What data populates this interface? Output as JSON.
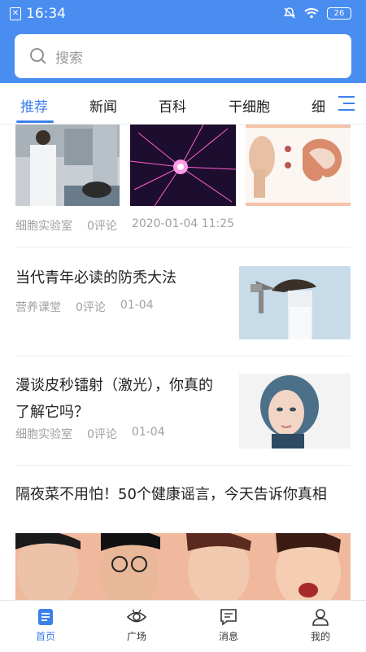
{
  "status_bar": {
    "time": "16:34",
    "battery": "26"
  },
  "search": {
    "placeholder": "搜索"
  },
  "tabs": [
    {
      "label": "推荐"
    },
    {
      "label": "新闻"
    },
    {
      "label": "百科"
    },
    {
      "label": "干细胞"
    },
    {
      "label": "细"
    }
  ],
  "feed": {
    "item1": {
      "source": "细胞实验室",
      "comments": "0评论",
      "time": "2020-01-04 11:25"
    },
    "item2": {
      "title": "当代青年必读的防秃大法",
      "source": "营养课堂",
      "comments": "0评论",
      "time": "01-04"
    },
    "item3": {
      "title": "漫谈皮秒镭射（激光），你真的了解它吗？",
      "source": "细胞实验室",
      "comments": "0评论",
      "time": "01-04"
    },
    "item4": {
      "title": "隔夜菜不用怕！50个健康谣言，今天告诉你真相"
    }
  },
  "bottom_nav": [
    {
      "label": "首页"
    },
    {
      "label": "广场"
    },
    {
      "label": "消息"
    },
    {
      "label": "我的"
    }
  ],
  "colors": {
    "accent": "#3c80ec",
    "header_bg": "#4a8df0"
  }
}
